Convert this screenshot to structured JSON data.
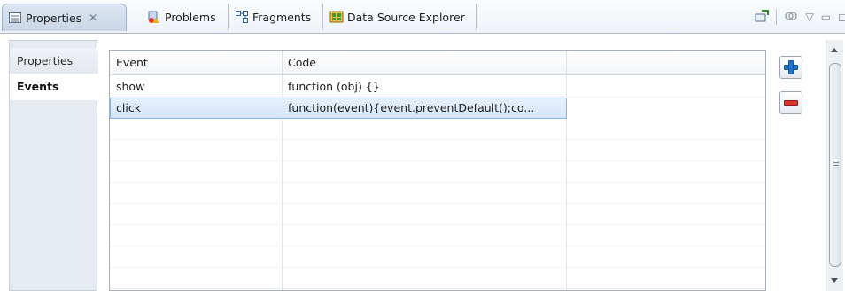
{
  "tabs": [
    {
      "label": "Properties",
      "icon": "properties-icon",
      "active": true
    },
    {
      "label": "Problems",
      "icon": "problems-icon"
    },
    {
      "label": "Fragments",
      "icon": "fragments-icon"
    },
    {
      "label": "Data Source Explorer",
      "icon": "data-source-icon"
    }
  ],
  "toolbar_icons": [
    "pin-icon",
    "link-icon",
    "view-menu-icon",
    "minimize-icon",
    "maximize-icon"
  ],
  "side_tabs": {
    "properties": "Properties",
    "events": "Events"
  },
  "table": {
    "columns": [
      "Event",
      "Code"
    ],
    "rows": [
      {
        "event": "show",
        "code": "function (obj) {}"
      },
      {
        "event": "click",
        "code": "function(event){event.preventDefault();co..."
      }
    ]
  },
  "buttons": {
    "add": "add-icon",
    "remove": "remove-icon"
  },
  "colors": {
    "selection": "#d6e6fa",
    "accent": "#1f73c8",
    "danger": "#d7342d"
  }
}
